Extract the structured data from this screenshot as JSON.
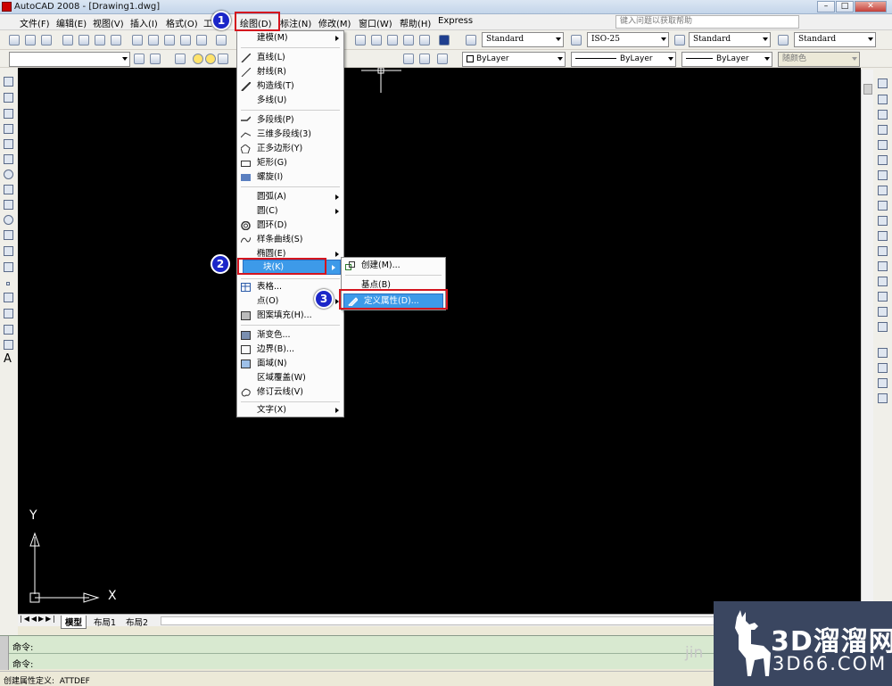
{
  "window": {
    "title": "AutoCAD 2008 - [Drawing1.dwg]"
  },
  "menubar": {
    "items": [
      "文件(F)",
      "编辑(E)",
      "视图(V)",
      "插入(I)",
      "格式(O)",
      "工",
      "绘图(D)",
      "标注(N)",
      "修改(M)",
      "窗口(W)",
      "帮助(H)",
      "Express"
    ],
    "help_placeholder": "键入问题以获取帮助"
  },
  "toolbar": {
    "text_style": "Standard",
    "dim_style": "ISO-25",
    "table_style": "Standard",
    "multileader_style": "Standard",
    "color": "ByLayer",
    "linetype": "ByLayer",
    "lineweight": "ByLayer",
    "plot_style": "随颜色"
  },
  "draw_menu": {
    "items": [
      {
        "label": "建模(M)",
        "submenu": true
      },
      {
        "label": "直线(L)"
      },
      {
        "label": "射线(R)"
      },
      {
        "label": "构造线(T)"
      },
      {
        "label": "多线(U)"
      },
      {
        "label": "多段线(P)"
      },
      {
        "label": "三维多段线(3)"
      },
      {
        "label": "正多边形(Y)"
      },
      {
        "label": "矩形(G)"
      },
      {
        "label": "螺旋(I)"
      },
      {
        "label": "圆弧(A)",
        "submenu": true
      },
      {
        "label": "圆(C)",
        "submenu": true
      },
      {
        "label": "圆环(D)"
      },
      {
        "label": "样条曲线(S)"
      },
      {
        "label": "椭圆(E)",
        "submenu": true
      },
      {
        "label": "块(K)",
        "submenu": true
      },
      {
        "label": "表格..."
      },
      {
        "label": "点(O)",
        "submenu": true
      },
      {
        "label": "图案填充(H)..."
      },
      {
        "label": "渐变色..."
      },
      {
        "label": "边界(B)..."
      },
      {
        "label": "面域(N)"
      },
      {
        "label": "区域覆盖(W)"
      },
      {
        "label": "修订云线(V)"
      },
      {
        "label": "文字(X)",
        "submenu": true
      }
    ]
  },
  "block_submenu": {
    "items": [
      "创建(M)...",
      "基点(B)",
      "定义属性(D)..."
    ]
  },
  "steps": [
    "1",
    "2",
    "3"
  ],
  "layout_tabs": [
    "模型",
    "布局1",
    "布局2"
  ],
  "ucs": {
    "x": "X",
    "y": "Y"
  },
  "command": {
    "line1": "命令:",
    "line2": "命令:"
  },
  "status": {
    "text": "创建属性定义:  ATTDEF"
  },
  "watermark": {
    "brand": "3D溜溜网",
    "url": "3D66.COM",
    "partial": "jin"
  },
  "colors": {
    "highlight": "#3d9ae9",
    "annotation_red": "#d4141e",
    "badge_blue": "#1b26c8"
  }
}
